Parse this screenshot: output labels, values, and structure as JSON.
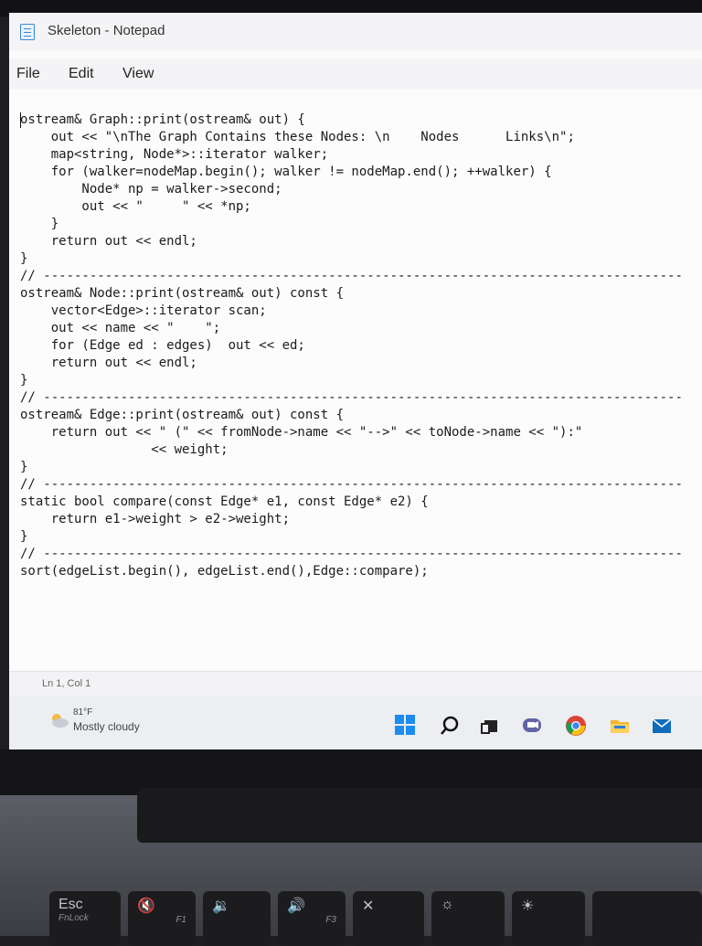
{
  "window": {
    "title": "Skeleton - Notepad"
  },
  "menu": {
    "file": "File",
    "edit": "Edit",
    "view": "View"
  },
  "editor": {
    "content": "ostream& Graph::print(ostream& out) {\n    out << \"\\nThe Graph Contains these Nodes: \\n    Nodes      Links\\n\";\n    map<string, Node*>::iterator walker;\n    for (walker=nodeMap.begin(); walker != nodeMap.end(); ++walker) {\n        Node* np = walker->second;\n        out << \"     \" << *np;\n    }\n    return out << endl;\n}\n// -----------------------------------------------------------------------------------\nostream& Node::print(ostream& out) const {\n    vector<Edge>::iterator scan;\n    out << name << \"    \";\n    for (Edge ed : edges)  out << ed;\n    return out << endl;\n}\n// -----------------------------------------------------------------------------------\nostream& Edge::print(ostream& out) const {\n    return out << \" (\" << fromNode->name << \"-->\" << toNode->name << \"):\"\n                 << weight;\n}\n// -----------------------------------------------------------------------------------\nstatic bool compare(const Edge* e1, const Edge* e2) {\n    return e1->weight > e2->weight;\n}\n// -----------------------------------------------------------------------------------\nsort(edgeList.begin(), edgeList.end(),Edge::compare);"
  },
  "status": {
    "position": "Ln 1, Col 1"
  },
  "taskbar": {
    "weather_temp": "81°F",
    "weather_desc": "Mostly cloudy"
  },
  "keyboard": {
    "esc": "Esc",
    "fnlock": "FnLock",
    "f1": "F1",
    "f3": "F3"
  },
  "icons": {
    "app": "notepad-icon",
    "weather": "cloud-sun-icon",
    "start": "windows-start-icon",
    "search": "search-icon",
    "taskview": "task-view-icon",
    "teams": "teams-chat-icon",
    "chrome": "chrome-icon",
    "explorer": "file-explorer-icon",
    "mail": "mail-icon"
  },
  "colors": {
    "accent": "#1d8cf0",
    "window_bg": "#fbfbfb",
    "taskbar_bg": "#eceef2"
  }
}
